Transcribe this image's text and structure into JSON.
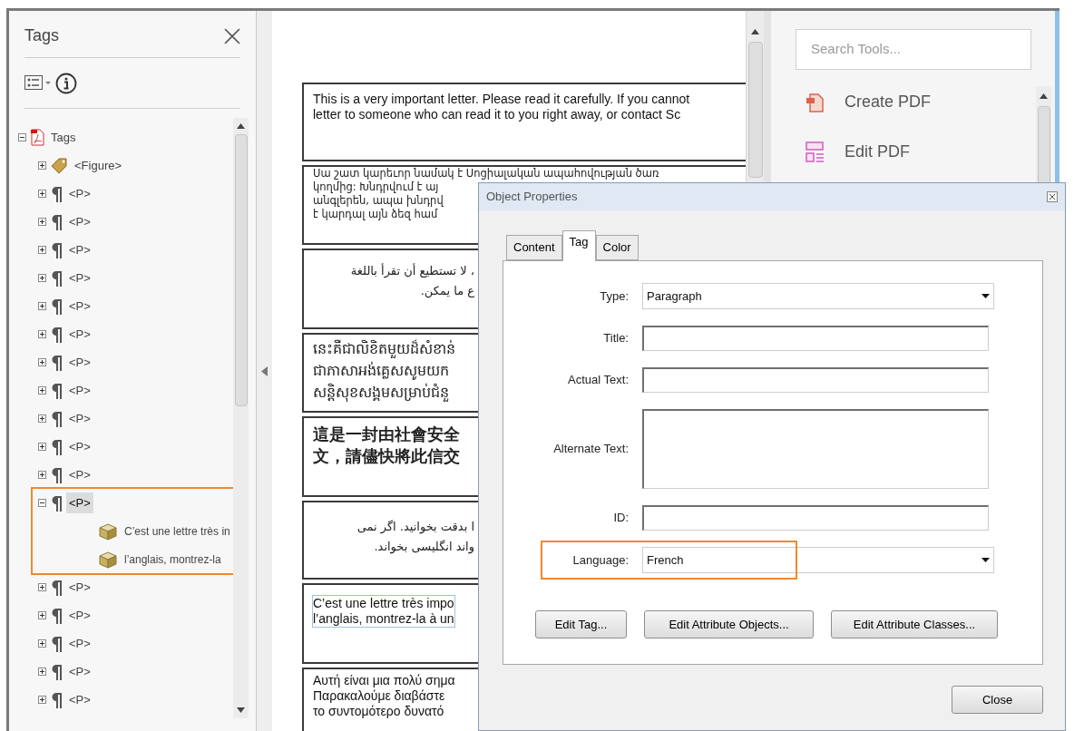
{
  "tags_panel": {
    "title": "Tags",
    "tree": {
      "label": "Tags",
      "kind": "root",
      "expanded": true,
      "selected": false,
      "children": [
        {
          "label": "<Figure>",
          "kind": "figure",
          "expanded": false,
          "selected": false
        },
        {
          "label": "<P>",
          "kind": "paragraph",
          "expanded": false,
          "selected": false
        },
        {
          "label": "<P>",
          "kind": "paragraph",
          "expanded": false,
          "selected": false
        },
        {
          "label": "<P>",
          "kind": "paragraph",
          "expanded": false,
          "selected": false
        },
        {
          "label": "<P>",
          "kind": "paragraph",
          "expanded": false,
          "selected": false
        },
        {
          "label": "<P>",
          "kind": "paragraph",
          "expanded": false,
          "selected": false
        },
        {
          "label": "<P>",
          "kind": "paragraph",
          "expanded": false,
          "selected": false
        },
        {
          "label": "<P>",
          "kind": "paragraph",
          "expanded": false,
          "selected": false
        },
        {
          "label": "<P>",
          "kind": "paragraph",
          "expanded": false,
          "selected": false
        },
        {
          "label": "<P>",
          "kind": "paragraph",
          "expanded": false,
          "selected": false
        },
        {
          "label": "<P>",
          "kind": "paragraph",
          "expanded": false,
          "selected": false
        },
        {
          "label": "<P>",
          "kind": "paragraph",
          "expanded": false,
          "selected": false
        },
        {
          "label": "<P>",
          "kind": "paragraph",
          "expanded": true,
          "selected": true,
          "highlighted": true,
          "children": [
            {
              "label": "C’est une lettre très in",
              "kind": "content",
              "selected": false
            },
            {
              "label": "l’anglais, montrez-la",
              "kind": "content",
              "selected": false
            }
          ]
        },
        {
          "label": "<P>",
          "kind": "paragraph",
          "expanded": false,
          "selected": false
        },
        {
          "label": "<P>",
          "kind": "paragraph",
          "expanded": false,
          "selected": false
        },
        {
          "label": "<P>",
          "kind": "paragraph",
          "expanded": false,
          "selected": false
        },
        {
          "label": "<P>",
          "kind": "paragraph",
          "expanded": false,
          "selected": false
        },
        {
          "label": "<P>",
          "kind": "paragraph",
          "expanded": false,
          "selected": false
        }
      ]
    }
  },
  "document": {
    "blocks": [
      {
        "kind": "latin",
        "selected": false,
        "lines": [
          "This is a very important letter. Please read it carefully. If you cannot",
          "letter to someone who can read it to you right away, or contact Sc"
        ]
      },
      {
        "kind": "armenian",
        "selected": false,
        "lines": [
          "Սա շատ կարեւոր նամակ է Սոցիալական ապահովության ծառ",
          "կողմից: Խնդրվում է այ",
          "անգլերեն, ապա խնդրվ",
          "է կարդալ այն ձեզ համ"
        ]
      },
      {
        "kind": "arabic",
        "selected": false,
        "lines": [
          "، لا تستطيع أن تقرأ باللغة",
          "ع ما يمكن."
        ]
      },
      {
        "kind": "khmer",
        "selected": false,
        "lines": [
          "នេះគឺជាលិខិតមួយដ៏សំខាន់",
          "ជាភាសាអង់គ្លេសសូមយក",
          "សន្តិសុខសង្គមសម្រាប់ជំនួ"
        ]
      },
      {
        "kind": "chinese",
        "selected": false,
        "lines": [
          "這是一封由社會安全",
          "文，請儘快將此信交"
        ]
      },
      {
        "kind": "arabic",
        "selected": false,
        "lines": [
          "ا بدقت بخوانید. اگر نمی",
          "واند انگلیسی بخواند."
        ]
      },
      {
        "kind": "latin",
        "selected": true,
        "lines": [
          "C’est une lettre très impo",
          "l’anglais, montrez-la à un"
        ]
      },
      {
        "kind": "greek",
        "selected": false,
        "lines": [
          "Αυτή είναι μια πολύ σημα",
          "Παρακαλούμε διαβάστε",
          "το συντομότερο δυνατό"
        ]
      }
    ]
  },
  "tools_panel": {
    "search": {
      "placeholder": "Search Tools..."
    },
    "tools": [
      {
        "label": "Create PDF",
        "kind": "create"
      },
      {
        "label": "Edit PDF",
        "kind": "edit"
      }
    ]
  },
  "dialog": {
    "title": "Object Properties",
    "tabs": [
      {
        "label": "Content",
        "selected": false
      },
      {
        "label": "Tag",
        "selected": true
      },
      {
        "label": "Color",
        "selected": false
      }
    ],
    "fields": [
      {
        "label": "Type:",
        "kind": "dropdown",
        "value": "Paragraph"
      },
      {
        "label": "Title:",
        "kind": "text"
      },
      {
        "label": "Actual Text:",
        "kind": "text"
      },
      {
        "label": "Alternate Text:",
        "kind": "textarea"
      },
      {
        "label": "ID:",
        "kind": "text"
      },
      {
        "label": "Language:",
        "kind": "dropdown",
        "value": "French",
        "highlighted": true
      }
    ],
    "buttons": [
      "Edit Tag...",
      "Edit Attribute Objects...",
      "Edit Attribute Classes..."
    ],
    "close_button": "Close"
  }
}
